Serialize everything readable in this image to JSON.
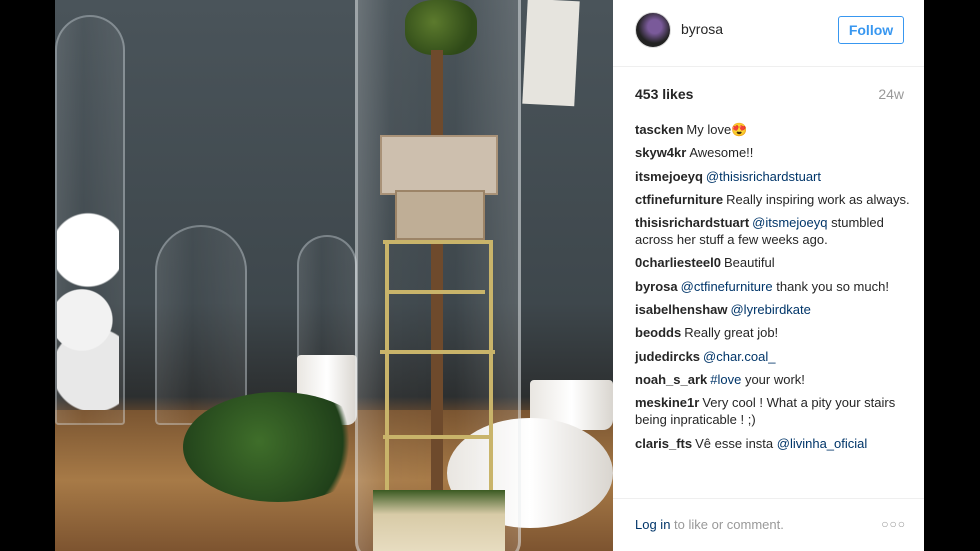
{
  "post": {
    "username": "byrosa",
    "follow_label": "Follow",
    "likes": "453 likes",
    "age": "24w"
  },
  "comments": [
    {
      "user": "tascken",
      "parts": [
        {
          "text": "My love😍",
          "mention": false
        }
      ]
    },
    {
      "user": "skyw4kr",
      "parts": [
        {
          "text": "Awesome!!",
          "mention": false
        }
      ]
    },
    {
      "user": "itsmejoeyq",
      "parts": [
        {
          "text": "@thisisrichardstuart",
          "mention": true
        }
      ]
    },
    {
      "user": "ctfinefurniture",
      "parts": [
        {
          "text": "Really inspiring work as always.",
          "mention": false
        }
      ]
    },
    {
      "user": "thisisrichardstuart",
      "parts": [
        {
          "text": "@itsmejoeyq",
          "mention": true
        },
        {
          "text": " stumbled across her stuff a few weeks ago. ",
          "mention": false
        }
      ]
    },
    {
      "user": "0charliesteel0",
      "parts": [
        {
          "text": "Beautiful",
          "mention": false
        }
      ]
    },
    {
      "user": "byrosa",
      "parts": [
        {
          "text": "@ctfinefurniture",
          "mention": true
        },
        {
          "text": " thank you so much!",
          "mention": false
        }
      ]
    },
    {
      "user": "isabelhenshaw",
      "parts": [
        {
          "text": "@lyrebirdkate",
          "mention": true
        }
      ]
    },
    {
      "user": "beodds",
      "parts": [
        {
          "text": "Really great job!",
          "mention": false
        }
      ]
    },
    {
      "user": "judedircks",
      "parts": [
        {
          "text": "@char.coal_",
          "mention": true
        }
      ]
    },
    {
      "user": "noah_s_ark",
      "parts": [
        {
          "text": "#love",
          "mention": true
        },
        {
          "text": " your work!",
          "mention": false
        }
      ]
    },
    {
      "user": "meskine1r",
      "parts": [
        {
          "text": "Very cool ! What a pity your stairs being inpraticable ! ;)",
          "mention": false
        }
      ]
    },
    {
      "user": "claris_fts",
      "parts": [
        {
          "text": "Vê esse insta ",
          "mention": false
        },
        {
          "text": "@livinha_oficial",
          "mention": true
        }
      ]
    }
  ],
  "footer": {
    "login_link": "Log in",
    "login_rest": " to like or comment.",
    "more_label": "○○○"
  },
  "icons": {
    "more": "more-options-icon",
    "avatar": "avatar"
  },
  "colors": {
    "accent": "#3897f0",
    "mention": "#003569",
    "muted": "#999999",
    "text": "#262626"
  }
}
